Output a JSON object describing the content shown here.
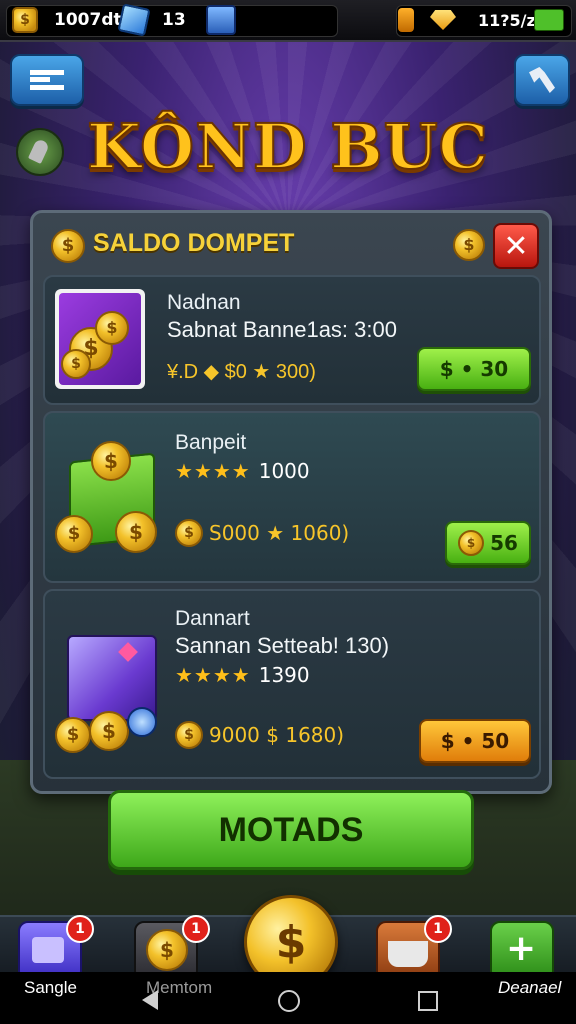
{
  "status_bar": {
    "currency1": "1007dt",
    "currency2": "13",
    "currency3": "11?5/z"
  },
  "title": "KÔND BUC",
  "panel": {
    "title": "SALDO DOMPET",
    "close_symbol": "✕",
    "items": [
      {
        "name": "Nadnan",
        "line1": "Sabnat Banne1as: 3:00",
        "line2": "¥.D ◆ $0 ★ 300)",
        "price": "$ • 30",
        "price_style": "green"
      },
      {
        "name": "Banpeit",
        "stars": "★★★★",
        "stars_value": "1000",
        "line2": "S000 ★ 1060)",
        "price": "56",
        "price_style": "green"
      },
      {
        "name": "Dannart",
        "line1": "Sannan Setteab! 130)",
        "stars": "★★★★",
        "stars_value": "1390",
        "line2": "9000 $ 1680)",
        "price": "$ • 50",
        "price_style": "orange"
      }
    ]
  },
  "main_button": "MOTADS",
  "bottom_nav": {
    "badges": [
      "1",
      "1",
      "1"
    ],
    "left_label": "Sangle",
    "mid_label": "Memtom",
    "right_label": "Deanael"
  },
  "icons": {
    "menu": "menu-icon",
    "settings": "hammer-icon",
    "back": "back-triangle-icon",
    "home": "home-circle-icon",
    "recent": "recent-square-icon"
  },
  "colors": {
    "accent_gold": "#f7c52a",
    "button_green": "#48b012",
    "button_orange": "#e07d0a",
    "close_red": "#d42a1e"
  }
}
